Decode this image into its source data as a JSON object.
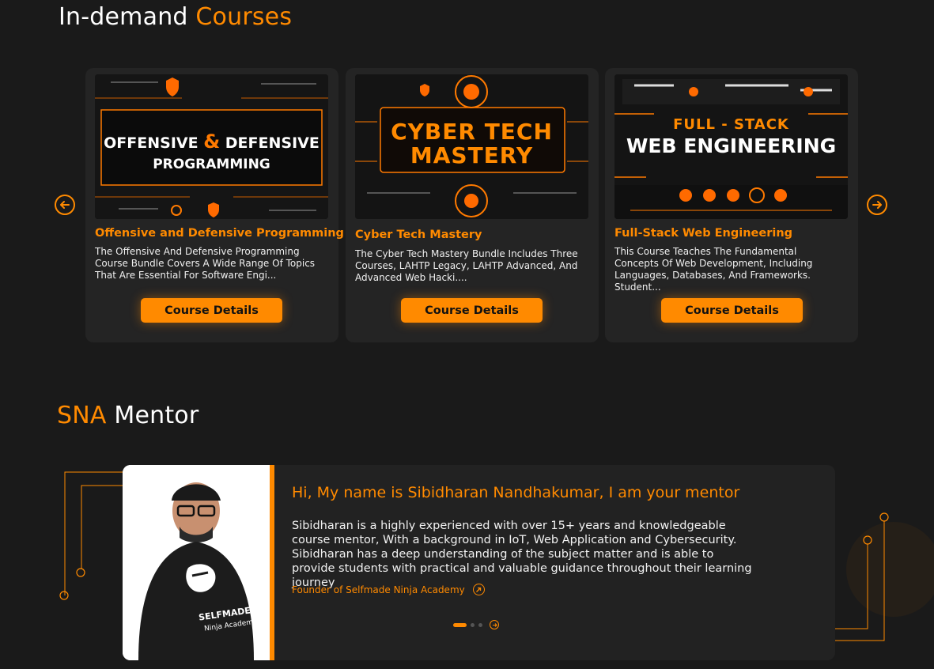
{
  "courses_section": {
    "title_plain": "In-demand",
    "title_accent": "Courses",
    "cards": [
      {
        "thumb_line1": "OFFENSIVE",
        "thumb_amp": "&",
        "thumb_line1b": "DEFENSIVE",
        "thumb_line2": "PROGRAMMING",
        "title": "Offensive and Defensive Programming",
        "description": "The Offensive And Defensive Programming Course Bundle Covers A Wide Range Of Topics That Are Essential For Software Engi...",
        "button": "Course Details"
      },
      {
        "thumb_line1": "CYBER TECH",
        "thumb_line2": "MASTERY",
        "title": "Cyber Tech Mastery",
        "description": "The Cyber Tech Mastery Bundle Includes Three Courses, LAHTP Legacy, LAHTP Advanced, And Advanced Web Hacki....",
        "button": "Course Details"
      },
      {
        "thumb_line1": "FULL - STACK",
        "thumb_line2": "WEB ENGINEERING",
        "title": "Full-Stack Web Engineering",
        "description": "This Course Teaches The Fundamental Concepts Of Web Development, Including Languages, Databases, And Frameworks. Student...",
        "button": "Course Details"
      }
    ]
  },
  "mentor_section": {
    "title_accent": "SNA",
    "title_plain": "Mentor",
    "heading": "Hi, My name is Sibidharan Nandhakumar, I am your mentor",
    "bio": "Sibidharan is a highly experienced with over 15+ years and knowledgeable course mentor, With a background in IoT, Web Application and Cybersecurity. Sibidharan has a deep understanding of the subject matter and is able to provide students with practical and valuable guidance throughout their learning journey",
    "role": "Founder of Selfmade Ninja Academy",
    "shirt_text_1": "SELFMADE",
    "shirt_text_2": "Ninja Academy"
  },
  "icons": {
    "prev": "arrow-left-circle-icon",
    "next": "arrow-right-circle-icon",
    "role": "arrow-up-right-circle-icon"
  },
  "colors": {
    "accent": "#ff8a00",
    "background": "#1a1a1a",
    "card": "#242424"
  }
}
